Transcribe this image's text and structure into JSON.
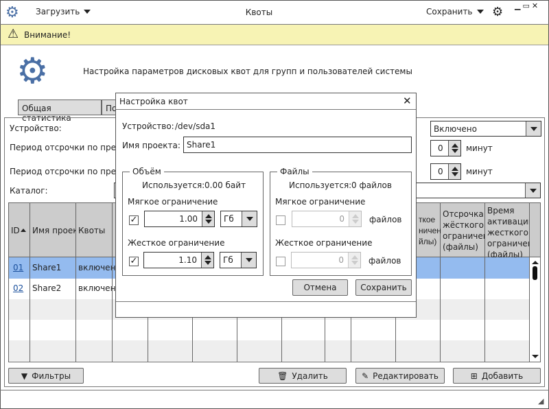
{
  "titlebar": {
    "title": "Квоты",
    "load_label": "Загрузить",
    "save_label": "Сохранить"
  },
  "warning": {
    "text": "Внимание!"
  },
  "header": {
    "text": "Настройка параметров дисковых квот для групп и пользователей системы"
  },
  "tabs": [
    {
      "label": "Общая статистика"
    },
    {
      "label": "По"
    }
  ],
  "form": {
    "device_label": "Устройство:",
    "grace1_label": "Период отсрочки по превы",
    "grace2_label": "Период отсрочки по превы",
    "catalog_label": "Каталог:",
    "state_value": "Включено",
    "grace1_value": "0",
    "grace2_value": "0",
    "unit": "минут"
  },
  "table": {
    "headers": [
      "ID",
      "Имя проек",
      "Квоты",
      "ткое ничен йлы)",
      "Отсрочка жёсткого ограничен (файлы)",
      "Время активации жесткого ограничен (файлы)"
    ],
    "rows": [
      {
        "id": "01",
        "name": "Share1",
        "quota": "включен"
      },
      {
        "id": "02",
        "name": "Share2",
        "quota": "включен"
      }
    ]
  },
  "buttons": {
    "filters": "Фильтры",
    "delete": "Удалить",
    "edit": "Редактировать",
    "add": "Добавить"
  },
  "dialog": {
    "title": "Настройка квот",
    "device_label": "Устройство:",
    "device_value": "/dev/sda1",
    "project_label": "Имя проекта:",
    "project_value": "Share1",
    "volume": {
      "legend": "Объём",
      "used_label": "Используется:",
      "used_value": "0.00 байт",
      "soft_label": "Мягкое ограничение",
      "soft_value": "1.00",
      "soft_unit": "Гб",
      "hard_label": "Жесткое ограничение",
      "hard_value": "1.10",
      "hard_unit": "Гб"
    },
    "files": {
      "legend": "Файлы",
      "used_label": "Используется:",
      "used_value": "0 файлов",
      "soft_label": "Мягкое ограничение",
      "soft_value": "0",
      "hard_label": "Жесткое ограничение",
      "hard_value": "0",
      "unit": "файлов"
    },
    "cancel": "Отмена",
    "save": "Сохранить"
  }
}
